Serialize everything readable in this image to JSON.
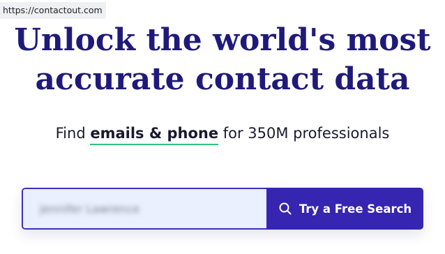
{
  "browser": {
    "url": "https://contactout.com"
  },
  "hero": {
    "headline_line1": "Unlock the world's most",
    "headline_line2": "accurate contact data",
    "subline_prefix": "Find ",
    "subline_highlight": "emails & phone",
    "subline_suffix": " for 350M professionals"
  },
  "search": {
    "input_value": "Jennifer Lawrence",
    "button_label": "Try a Free Search",
    "button_icon": "search-icon"
  },
  "colors": {
    "headline": "#1f1a7a",
    "button_bg": "#3525b0",
    "input_bg": "#eaf0fd",
    "underline": "#2ec27e"
  }
}
